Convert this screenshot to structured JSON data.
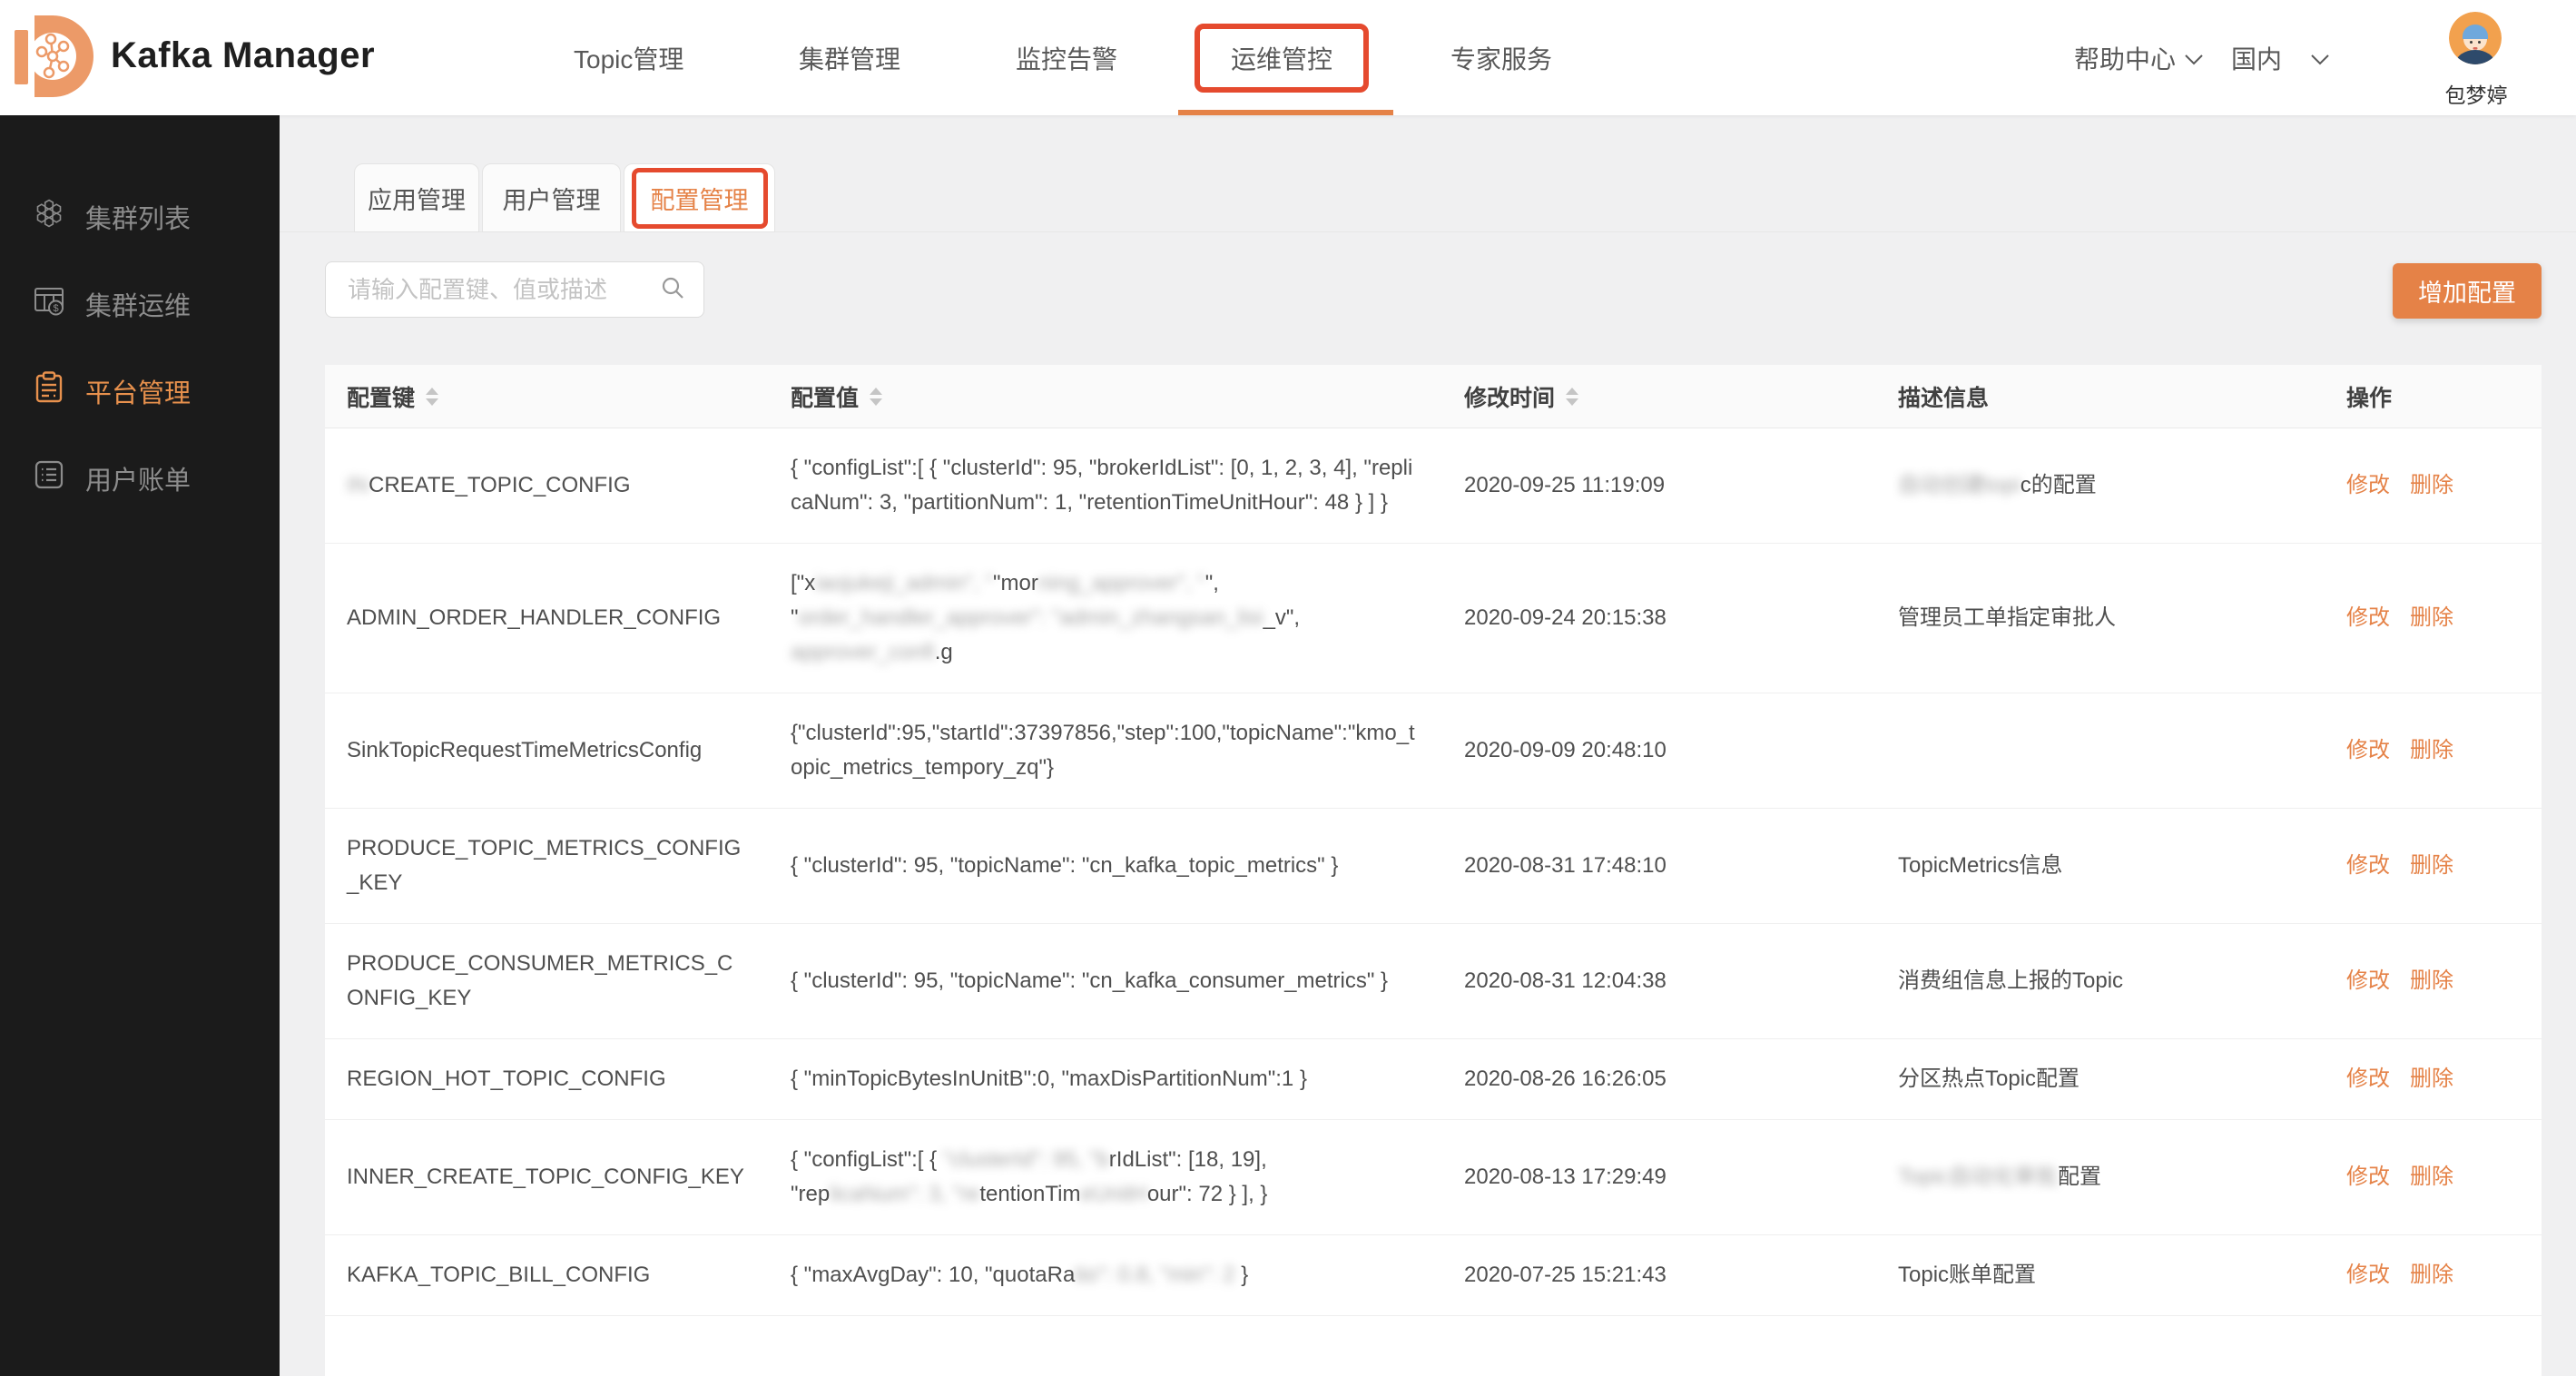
{
  "colors": {
    "accent": "#E58247",
    "logo_orange": "#EC9A68",
    "annotation_red": "#E54A2E",
    "sidebar_bg": "#1B1B1B",
    "page_bg": "#F0F0F1"
  },
  "header": {
    "app_title": "Kafka Manager",
    "nav": [
      {
        "label": "Topic管理"
      },
      {
        "label": "集群管理"
      },
      {
        "label": "监控告警"
      },
      {
        "label": "运维管控",
        "active": true,
        "annotated": true
      },
      {
        "label": "专家服务"
      }
    ],
    "help_label": "帮助中心",
    "region_label": "国内",
    "user_name": "包梦婷"
  },
  "sidebar": {
    "items": [
      {
        "label": "集群列表",
        "icon": "cluster-list-icon"
      },
      {
        "label": "集群运维",
        "icon": "cluster-ops-icon"
      },
      {
        "label": "平台管理",
        "icon": "platform-admin-icon",
        "active": true
      },
      {
        "label": "用户账单",
        "icon": "user-bill-icon"
      }
    ]
  },
  "main": {
    "tabs": [
      {
        "label": "应用管理"
      },
      {
        "label": "用户管理"
      },
      {
        "label": "配置管理",
        "active": true,
        "annotated": true
      }
    ],
    "search_placeholder": "请输入配置键、值或描述",
    "add_button_label": "增加配置",
    "table": {
      "columns": [
        {
          "label": "配置键",
          "sortable": true
        },
        {
          "label": "配置值",
          "sortable": true
        },
        {
          "label": "修改时间",
          "sortable": true
        },
        {
          "label": "描述信息",
          "sortable": false
        },
        {
          "label": "操作",
          "sortable": false
        }
      ],
      "actions": [
        "修改",
        "删除"
      ],
      "rows": [
        {
          "key": [
            {
              "t": "IN",
              "b": true
            },
            {
              "t": "CREATE_TOPIC_CONFIG"
            }
          ],
          "value": [
            [
              {
                "t": "{ \"configList\":[ { \"clusterId\": 95, \"brokerIdList\": [0, 1, 2, 3, 4], \"replicaNum\": 3, \"partitionNum\": 1, \"retentionTimeUnitHour\": 48 } ] }"
              }
            ]
          ],
          "time": "2020-09-25 11:19:09",
          "desc": [
            {
              "t": "自动创建topi",
              "b": true
            },
            {
              "t": "c的配置"
            }
          ]
        },
        {
          "key": [
            {
              "t": "ADMIN_ORDER_HANDLER_CONFIG"
            }
          ],
          "value": [
            [
              {
                "t": "[\"x"
              },
              {
                "t": "iaojukeji_admin\", \"",
                "b": true
              },
              {
                "t": "\"mor"
              },
              {
                "t": "ning_approver\", \"",
                "b": true
              },
              {
                "t": "\","
              }
            ],
            [
              {
                "t": "\""
              },
              {
                "t": "order_handler_approver\": \"admin_zhangsan_lisi",
                "b": true
              },
              {
                "t": "_v\","
              }
            ],
            [
              {
                "t": "approver_confi",
                "b": true
              },
              {
                "t": ".g"
              }
            ]
          ],
          "time": "2020-09-24 20:15:38",
          "desc": [
            {
              "t": "管理员工单指定审批人"
            }
          ]
        },
        {
          "key": [
            {
              "t": "SinkTopicRequestTimeMetricsConfig"
            }
          ],
          "value": [
            [
              {
                "t": "{\"clusterId\":95,\"startId\":37397856,\"step\":100,\"topicName\":\"kmo_topic_metrics_tempory_zq\"}"
              }
            ]
          ],
          "time": "2020-09-09 20:48:10",
          "desc": []
        },
        {
          "key": [
            {
              "t": "PRODUCE_TOPIC_METRICS_CONFIG_KEY"
            }
          ],
          "value": [
            [
              {
                "t": "{ \"clusterId\": 95, \"topicName\": \"cn_kafka_topic_metrics\" }"
              }
            ]
          ],
          "time": "2020-08-31 17:48:10",
          "desc": [
            {
              "t": "TopicMetrics信息"
            }
          ]
        },
        {
          "key": [
            {
              "t": "PRODUCE_CONSUMER_METRICS_CONFIG_KEY"
            }
          ],
          "value": [
            [
              {
                "t": "{ \"clusterId\": 95, \"topicName\": \"cn_kafka_consumer_metrics\" }"
              }
            ]
          ],
          "time": "2020-08-31 12:04:38",
          "desc": [
            {
              "t": "消费组信息上报的Topic"
            }
          ]
        },
        {
          "key": [
            {
              "t": "REGION_HOT_TOPIC_CONFIG"
            }
          ],
          "value": [
            [
              {
                "t": "{ \"minTopicBytesInUnitB\":0, \"maxDisPartitionNum\":1 }"
              }
            ]
          ],
          "time": "2020-08-26 16:26:05",
          "desc": [
            {
              "t": "分区热点Topic配置"
            }
          ]
        },
        {
          "key": [
            {
              "t": "INNER_CREATE_TOPIC_CONFIG_KEY"
            }
          ],
          "value": [
            [
              {
                "t": "{ \"configList\":[ { "
              },
              {
                "t": "\"clusterId\": 95, \"b",
                "b": true
              },
              {
                "t": "rIdList\": [18, 19],"
              }
            ],
            [
              {
                "t": "\"rep"
              },
              {
                "t": "licaNum\": 3, \"re",
                "b": true
              },
              {
                "t": "tentionTim"
              },
              {
                "t": "eUnitH",
                "b": true
              },
              {
                "t": "our\": 72 } ], }"
              }
            ]
          ],
          "time": "2020-08-13 17:29:49",
          "desc": [
            {
              "t": "Topic自动化审批",
              "b": true
            },
            {
              "t": "配置"
            }
          ]
        },
        {
          "key": [
            {
              "t": "KAFKA_TOPIC_BILL_CONFIG"
            }
          ],
          "value": [
            [
              {
                "t": "{ \"maxAvgDay\": 10, \"quotaRa"
              },
              {
                "t": "tio\": 0.8, \"min\": 2",
                "b": true
              },
              {
                "t": " }"
              }
            ]
          ],
          "time": "2020-07-25 15:21:43",
          "desc": [
            {
              "t": "Topic账单配置"
            }
          ]
        }
      ]
    }
  }
}
